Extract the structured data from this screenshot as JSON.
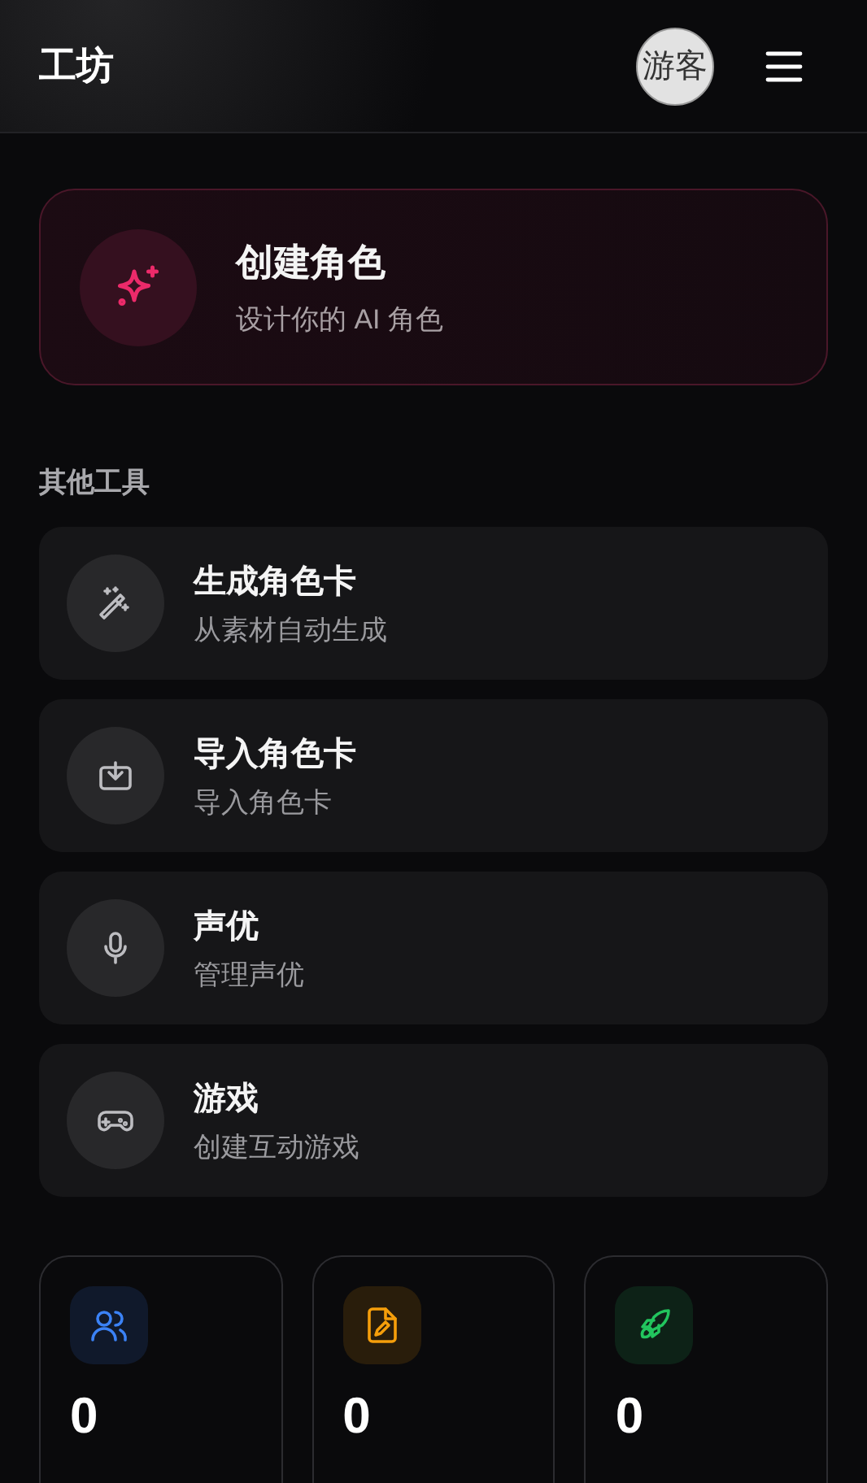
{
  "header": {
    "title": "工坊",
    "avatar": "游客"
  },
  "feature": {
    "title": "创建角色",
    "subtitle": "设计你的 AI 角色"
  },
  "section_title": "其他工具",
  "tools": [
    {
      "kind": "wand",
      "title": "生成角色卡",
      "subtitle": "从素材自动生成"
    },
    {
      "kind": "import",
      "title": "导入角色卡",
      "subtitle": "导入角色卡"
    },
    {
      "kind": "mic",
      "title": "声优",
      "subtitle": "管理声优"
    },
    {
      "kind": "gamepad",
      "title": "游戏",
      "subtitle": "创建互动游戏"
    }
  ],
  "stats": [
    {
      "kind": "users",
      "color": "#3b82f6",
      "value": "0"
    },
    {
      "kind": "draft",
      "color": "#f59e0b",
      "value": "0"
    },
    {
      "kind": "rocket",
      "color": "#22c55e",
      "value": "0"
    }
  ]
}
